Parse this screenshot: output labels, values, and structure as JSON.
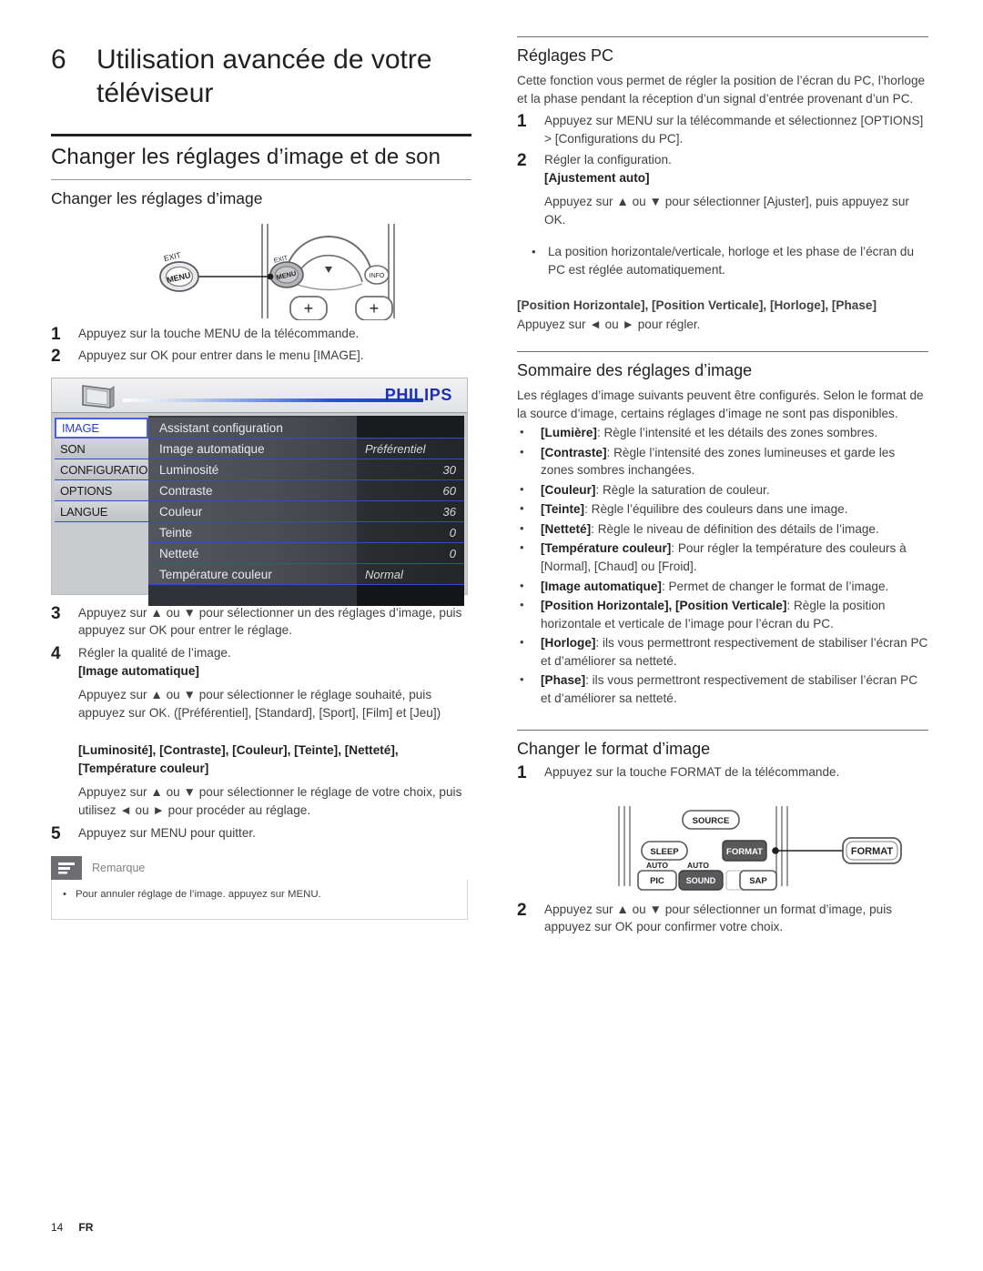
{
  "chapter": {
    "number": "6",
    "title": "Utilisation avancée de votre téléviseur"
  },
  "left": {
    "section_title": "Changer les réglages d’image et de son",
    "subsection_title": "Changer les réglages d’image",
    "steps_top": [
      {
        "num": "1",
        "text": "Appuyez sur la touche MENU de la télécommande."
      },
      {
        "num": "2",
        "text": "Appuyez sur OK pour entrer dans le menu [IMAGE]."
      }
    ],
    "remote_menu": {
      "callout_label": "MENU",
      "callout_sub": "EXIT",
      "key_menu": "MENU",
      "key_menu_sub": "EXIT",
      "key_info": "INFO",
      "plus_left": "+",
      "plus_right": "+"
    },
    "tv_menu": {
      "brand": "PHILIPS",
      "categories": [
        "IMAGE",
        "SON",
        "CONFIGURATION",
        "OPTIONS",
        "LANGUE"
      ],
      "selected_category": "IMAGE",
      "items": [
        {
          "label": "Assistant configuration",
          "value": ""
        },
        {
          "label": "Image automatique",
          "value": "Préférentiel"
        },
        {
          "label": "Luminosité",
          "value": "30"
        },
        {
          "label": "Contraste",
          "value": "60"
        },
        {
          "label": "Couleur",
          "value": "36"
        },
        {
          "label": "Teinte",
          "value": "0"
        },
        {
          "label": "Netteté",
          "value": "0"
        },
        {
          "label": "Température couleur",
          "value": "Normal"
        }
      ]
    },
    "step3": {
      "num": "3",
      "text": "Appuyez sur ▲ ou ▼ pour sélectionner un des réglages d’image, puis appuyez sur OK pour entrer le réglage."
    },
    "step4": {
      "num": "4",
      "line1": "Régler la qualité de l’image.",
      "bold1": "[Image automatique]",
      "para1": "Appuyez sur ▲ ou ▼ pour sélectionner le réglage souhaité, puis appuyez sur OK. ([Préférentiel], [Standard], [Sport], [Film] et [Jeu])",
      "bold2": "[Luminosité], [Contraste], [Couleur], [Teinte], [Netteté], [Température couleur]",
      "para2": "Appuyez sur ▲ ou ▼ pour sélectionner le réglage de votre choix, puis utilisez ◄ ou ► pour procéder au réglage."
    },
    "step5": {
      "num": "5",
      "text": "Appuyez sur MENU pour quitter."
    },
    "note": {
      "title": "Remarque",
      "items": [
        "Pour annuler réglage de l’image. appuyez sur MENU."
      ]
    }
  },
  "right": {
    "pc_settings": {
      "title": "Réglages PC",
      "intro": "Cette fonction vous permet de régler la position de l’écran du PC, l’horloge et la phase pendant la réception d’un signal d’entrée provenant d’un PC.",
      "step1_num": "1",
      "step1_text": "Appuyez sur MENU sur la télécommande et sélectionnez [OPTIONS] > [Configurations du PC].",
      "step2_num": "2",
      "step2_line1": "Régler la configuration.",
      "step2_bold": "[Ajustement auto]",
      "step2_para": "Appuyez sur ▲ ou ▼ pour sélectionner [Ajuster], puis appuyez sur OK.",
      "step2_bullet": "La position horizontale/verticale, horloge et les phase de l’écran du PC est réglée automatiquement.",
      "tail_bold": "[Position Horizontale], [Position Verticale], [Horloge], [Phase]",
      "tail_para": "Appuyez sur ◄ ou ► pour régler."
    },
    "summary": {
      "title": "Sommaire des réglages d’image",
      "intro": "Les réglages d’image suivants peuvent être configurés. Selon le format de la source d’image, certains réglages d’image ne sont pas disponibles.",
      "bullets": [
        {
          "term": "[Lumière]",
          "desc": ": Règle l’intensité et les détails des zones sombres."
        },
        {
          "term": "[Contraste]",
          "desc": ": Règle l’intensité des zones lumineuses et garde les zones sombres inchangées."
        },
        {
          "term": "[Couleur]",
          "desc": ": Règle la saturation de couleur."
        },
        {
          "term": "[Teinte]",
          "desc": ": Règle l’équilibre des couleurs dans une image."
        },
        {
          "term": "[Netteté]",
          "desc": ": Règle le niveau de définition des détails de l’image."
        },
        {
          "term": "[Température couleur]",
          "desc": ": Pour régler la température des couleurs à [Normal], [Chaud] ou [Froid]."
        },
        {
          "term": "[Image automatique]",
          "desc": ": Permet de changer le format de l’image."
        },
        {
          "term": "[Position Horizontale], [Position Verticale]",
          "desc": ": Règle la position horizontale et verticale de l’image pour l’écran du PC."
        },
        {
          "term": "[Horloge]",
          "desc": ": ils vous permettront respectivement de stabiliser l’écran PC et d’améliorer sa netteté."
        },
        {
          "term": "[Phase]",
          "desc": ": ils vous permettront respectivement de stabiliser l’écran PC et d’améliorer sa netteté."
        }
      ]
    },
    "format": {
      "title": "Changer le format d’image",
      "step1_num": "1",
      "step1_text": "Appuyez sur la touche FORMAT de la télécommande.",
      "step2_num": "2",
      "step2_text": "Appuyez sur ▲ ou ▼ pour sélectionner un format d’image, puis appuyez sur OK pour confirmer votre choix.",
      "remote": {
        "source": "SOURCE",
        "sleep": "SLEEP",
        "format_key": "FORMAT",
        "callout": "FORMAT",
        "auto1": "AUTO",
        "pic": "PIC",
        "auto2": "AUTO",
        "sound": "SOUND",
        "sap": "SAP"
      }
    }
  },
  "footer": {
    "page": "14",
    "locale": "FR"
  }
}
